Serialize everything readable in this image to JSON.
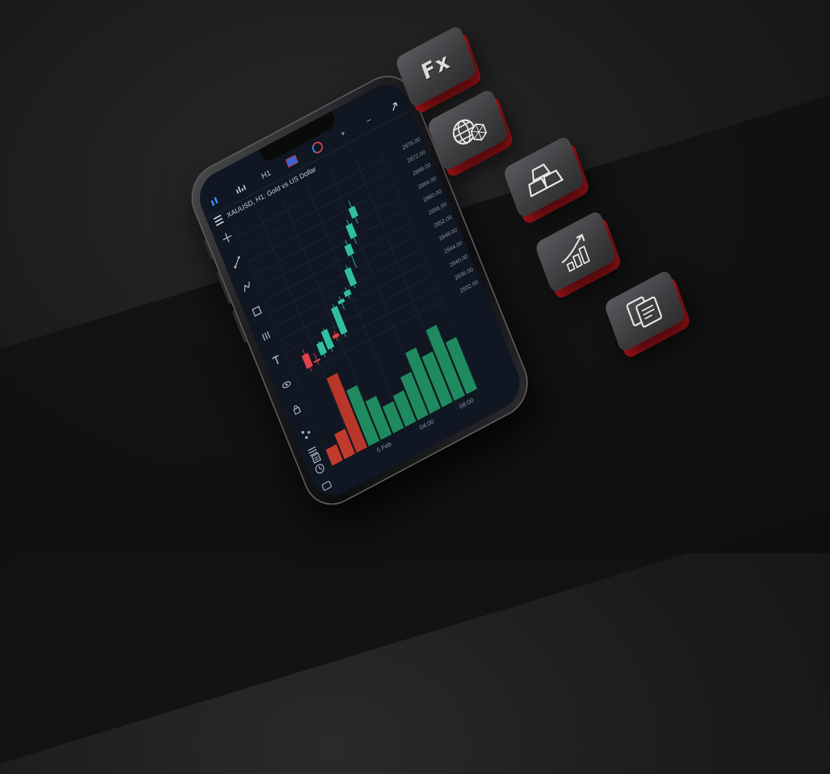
{
  "toolbar": {
    "items": [
      {
        "icon": "candles-icon",
        "label": ""
      },
      {
        "icon": "indicators-icon",
        "label": ""
      },
      {
        "icon": "",
        "label": "H1"
      },
      {
        "icon": "flag-icon",
        "label": ""
      },
      {
        "icon": "clock-icon",
        "label": ""
      },
      {
        "icon": "",
        "label": "+"
      },
      {
        "icon": "",
        "label": "–"
      },
      {
        "icon": "expand-icon",
        "label": ""
      }
    ]
  },
  "symbol": {
    "title": "XAUUSD, H1: Gold vs US Dollar"
  },
  "chart_data": {
    "type": "candlestick",
    "y_ticks": [
      "2876.00",
      "2872.00",
      "2868.00",
      "2864.00",
      "2860.00",
      "2856.00",
      "2852.00",
      "2848.00",
      "2844.00",
      "2840.00",
      "2836.00",
      "2832.00"
    ],
    "x_ticks": [
      "5 Feb",
      "04:00",
      "08:00"
    ],
    "ylim": [
      2830,
      2878
    ],
    "candles": [
      {
        "open": 2837.0,
        "high": 2838.5,
        "low": 2832.0,
        "close": 2833.0
      },
      {
        "open": 2834.0,
        "high": 2836.0,
        "low": 2832.5,
        "close": 2833.5
      },
      {
        "open": 2834.5,
        "high": 2838.5,
        "low": 2833.5,
        "close": 2838.0
      },
      {
        "open": 2835.0,
        "high": 2841.0,
        "low": 2834.0,
        "close": 2840.5
      },
      {
        "open": 2838.0,
        "high": 2839.0,
        "low": 2836.0,
        "close": 2837.0
      },
      {
        "open": 2837.0,
        "high": 2846.0,
        "low": 2836.0,
        "close": 2845.0
      },
      {
        "open": 2845.0,
        "high": 2847.0,
        "low": 2843.0,
        "close": 2846.0
      },
      {
        "open": 2846.0,
        "high": 2848.5,
        "low": 2845.0,
        "close": 2847.5
      },
      {
        "open": 2848.0,
        "high": 2854.0,
        "low": 2847.0,
        "close": 2853.0
      },
      {
        "open": 2856.0,
        "high": 2860.5,
        "low": 2852.0,
        "close": 2859.0
      },
      {
        "open": 2860.0,
        "high": 2865.5,
        "low": 2858.0,
        "close": 2864.0
      },
      {
        "open": 2865.0,
        "high": 2870.0,
        "low": 2863.0,
        "close": 2868.0
      }
    ],
    "bull_color": "#2fbfa0",
    "bear_color": "#e0414a",
    "volume": {
      "colors": [
        "#c23a2c",
        "#c23a2c",
        "#b8362a",
        "#1f8a60",
        "#1f8a60",
        "#1f8a60",
        "#1f8a60",
        "#1f8a60",
        "#1f8a60",
        "#1f8a60",
        "#1f8a60",
        "#1f8a60"
      ],
      "values": [
        22,
        34,
        100,
        75,
        52,
        36,
        42,
        58,
        82,
        68,
        95,
        70
      ]
    }
  },
  "tiles": [
    {
      "name": "fx-tile",
      "label": "Fx",
      "icon": ""
    },
    {
      "name": "crypto-tile",
      "label": "",
      "icon": "globe-crypto-icon"
    },
    {
      "name": "metals-tile",
      "label": "",
      "icon": "gold-bars-icon"
    },
    {
      "name": "growth-tile",
      "label": "",
      "icon": "growth-chart-icon"
    },
    {
      "name": "documents-tile",
      "label": "",
      "icon": "documents-icon"
    }
  ],
  "colors": {
    "accent_red": "#b8161b",
    "chart_bg": "#101722",
    "toolbar_active": "#3d8bff"
  }
}
